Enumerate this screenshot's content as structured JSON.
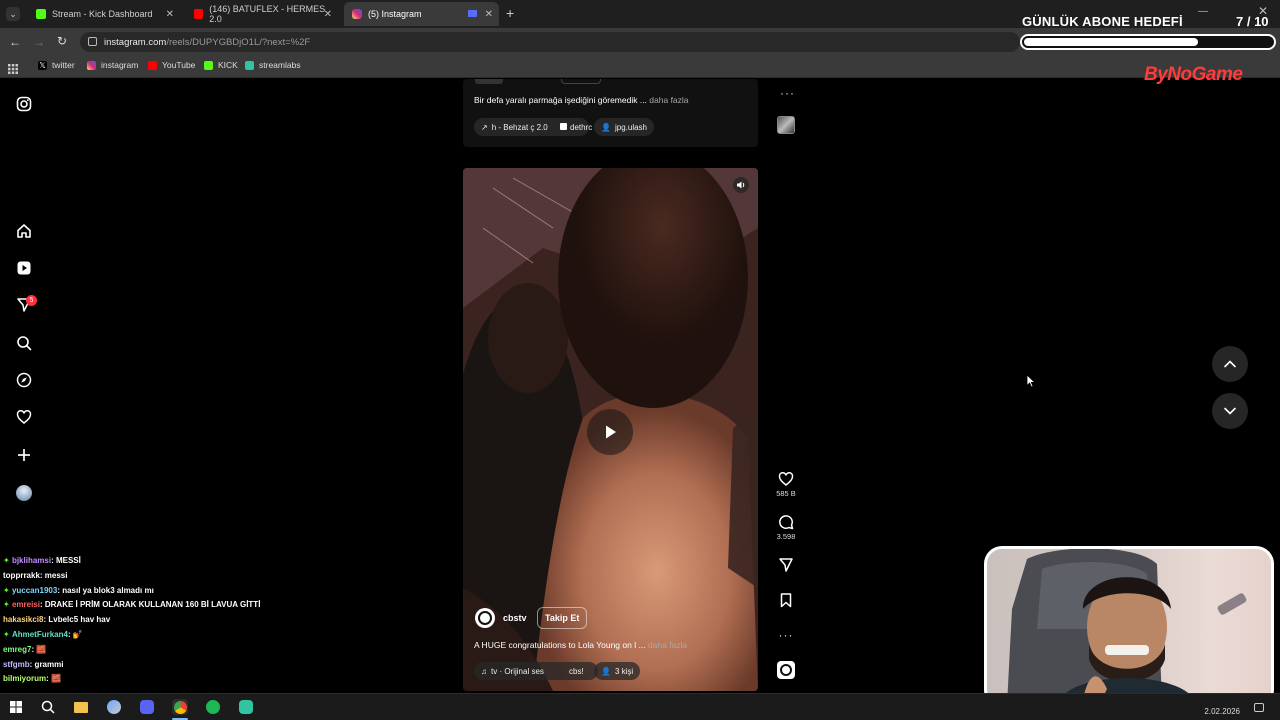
{
  "browser": {
    "tabs": [
      {
        "title": "Stream - Kick Dashboard",
        "favicon": "kick-icon",
        "color": "#53fc18"
      },
      {
        "title": "(146) BATUFLEX - HERMES 2.0",
        "favicon": "youtube-icon",
        "color": "#ff0000"
      },
      {
        "title": "(5) Instagram",
        "favicon": "instagram-icon",
        "color": "#d62976"
      }
    ],
    "url_host": "instagram.com",
    "url_path": "/reels/DUPYGBDjO1L/?next=%2F",
    "bookmarks": [
      {
        "label": "twitter",
        "icon": "x-icon"
      },
      {
        "label": "instagram",
        "icon": "instagram-icon"
      },
      {
        "label": "YouTube",
        "icon": "youtube-icon"
      },
      {
        "label": "KICK",
        "icon": "kick-icon"
      },
      {
        "label": "streamlabs",
        "icon": "streamlabs-icon"
      }
    ]
  },
  "reels": {
    "previous": {
      "caption": "Bir defa yaralı parmağa işediğini göremedik ...",
      "more": "daha fazla",
      "pills": [
        "h - Behzat ç 2.0",
        "dethrc",
        "jpg.ulash"
      ]
    },
    "current": {
      "username": "cbstv",
      "follow_label": "Takip Et",
      "caption": "A HUGE congratulations to Lola Young on l ...",
      "more": "daha fazla",
      "audio": "tv · Orijinal ses",
      "audio_right": "cbs!",
      "people": "3 kişi",
      "likes": "585 B",
      "comments": "3.598"
    }
  },
  "sidebar": {
    "notification_badge": "5"
  },
  "overlay": {
    "goal_title": "GÜNLÜK ABONE HEDEFİ",
    "goal_count": "7 / 10",
    "goal_progress": 0.7,
    "brand": "ByNoGame"
  },
  "chat": [
    {
      "user": "bjklihamsi",
      "text": ": MESSİ",
      "color": "#c58cff",
      "badge": true
    },
    {
      "user": "topprrakk",
      "text": ": messi",
      "color": "#ffffff",
      "badge": false
    },
    {
      "user": "yuccan1903",
      "text": ": nasıl ya blok3 almadı mı",
      "color": "#7fd7ff",
      "badge": true
    },
    {
      "user": "emreisi",
      "text": ": DRAKE İ PRİM OLARAK KULLANAN 160 Bİ LAVUA GİTTİ",
      "color": "#ff6060",
      "badge": true
    },
    {
      "user": "hakasikci8",
      "text": ": Lvbelc5 hav hav",
      "color": "#ffd27a",
      "badge": false
    },
    {
      "user": "AhmetFurkan4",
      "text": ": 💅",
      "color": "#5ee0c8",
      "badge": true
    },
    {
      "user": "emreg7",
      "text": ": 🧱",
      "color": "#7cff7c",
      "badge": false
    },
    {
      "user": "stfgmb",
      "text": ": grammi",
      "color": "#c8b6ff",
      "badge": false
    },
    {
      "user": "bilmiyorum",
      "text": ": 🧱",
      "color": "#b6ff6a",
      "badge": false
    }
  ],
  "taskbar": {
    "date": "2.02.2026"
  }
}
